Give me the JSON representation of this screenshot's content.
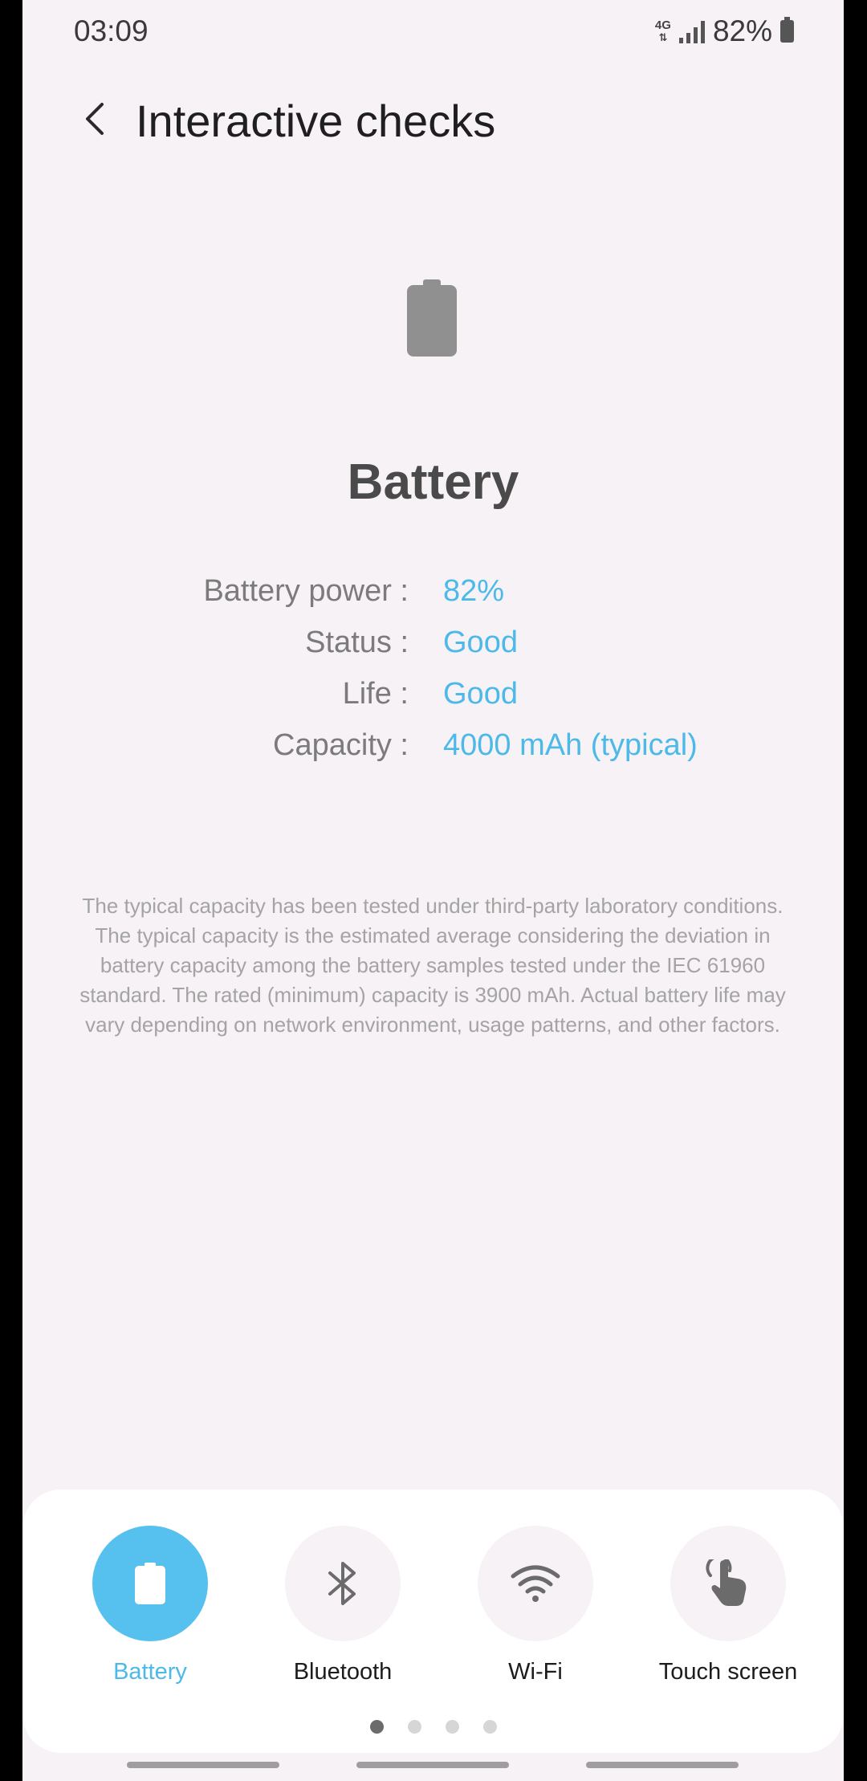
{
  "status_bar": {
    "time": "03:09",
    "network": "4G",
    "battery_percent": "82%",
    "icons": [
      "4g-icon",
      "signal-icon",
      "battery-icon"
    ]
  },
  "app_bar": {
    "title": "Interactive checks",
    "back_icon": "chevron-left-icon"
  },
  "hero": {
    "icon": "battery-icon",
    "title": "Battery"
  },
  "info": {
    "power_label": "Battery power :",
    "power_value": "82%",
    "status_label": "Status :",
    "status_value": "Good",
    "life_label": "Life :",
    "life_value": "Good",
    "capacity_label": "Capacity :",
    "capacity_value": "4000 mAh (typical)"
  },
  "disclaimer": "The typical capacity has been tested under third-party laboratory conditions. The typical capacity is the estimated average considering the deviation in battery capacity among the battery samples tested under the IEC 61960 standard. The rated (minimum) capacity is 3900 mAh. Actual battery life may vary depending on network environment, usage patterns, and other factors.",
  "tiles": [
    {
      "label": "Battery",
      "icon": "battery-icon",
      "active": true
    },
    {
      "label": "Bluetooth",
      "icon": "bluetooth-icon",
      "active": false
    },
    {
      "label": "Wi-Fi",
      "icon": "wifi-icon",
      "active": false
    },
    {
      "label": "Touch screen",
      "icon": "touch-icon",
      "active": false
    }
  ],
  "pagination": {
    "pages": 4,
    "current": 1
  },
  "colors": {
    "accent": "#4cb9e9",
    "active_tile": "#56c1ee",
    "background": "#f7f2f5"
  }
}
